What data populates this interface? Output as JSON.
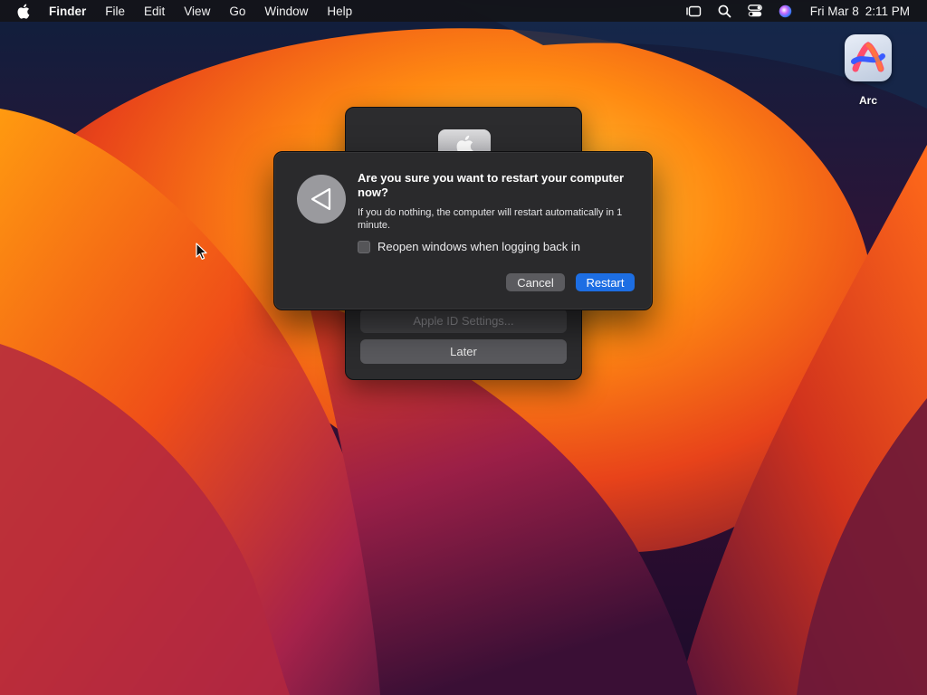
{
  "menubar": {
    "apple_icon": "apple-logo-icon",
    "app_name": "Finder",
    "items": [
      "File",
      "Edit",
      "View",
      "Go",
      "Window",
      "Help"
    ],
    "status_icons": [
      "stage-manager-icon",
      "search-icon",
      "control-center-icon",
      "siri-icon"
    ],
    "date": "Fri Mar 8",
    "time": "2:11 PM"
  },
  "desktop": {
    "icons": [
      {
        "label": "Arc",
        "icon": "arc-browser-icon"
      }
    ]
  },
  "update_panel": {
    "logo_icon": "apple-logo-icon",
    "apple_id_label": "Apple ID Settings...",
    "later_label": "Later"
  },
  "restart_dialog": {
    "icon": "restart-triangle-icon",
    "title": "Are you sure you want to restart your computer now?",
    "message": "If you do nothing, the computer will restart automatically in 1 minute.",
    "checkbox_label": "Reopen windows when logging back in",
    "checkbox_checked": false,
    "cancel_label": "Cancel",
    "restart_label": "Restart"
  },
  "colors": {
    "accent": "#1d6ee3",
    "dialog_bg": "#2a2a2c",
    "menubar_bg": "#141418"
  }
}
